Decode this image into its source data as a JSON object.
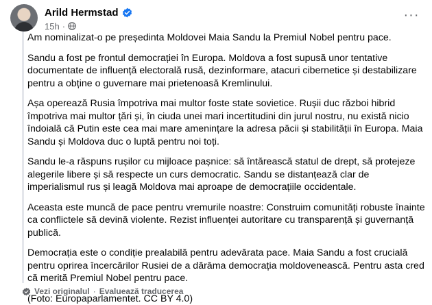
{
  "post": {
    "author": "Arild Hermstad",
    "time": "15h",
    "separator": "·",
    "more_label": "···",
    "paragraphs": [
      "Am nominalizat-o pe președinta Moldovei Maia Sandu la Premiul Nobel pentru pace.",
      "Sandu a fost pe frontul democrației în Europa. Moldova a fost supusă unor tentative documentate de influență electorală rusă, dezinformare, atacuri cibernetice și destabilizare pentru a obține o guvernare mai prietenoasă Kremlinului.",
      "Așa operează Rusia împotriva mai multor foste state sovietice. Rușii duc război hibrid împotriva mai multor țări și, în ciuda unei mari incertitudini din jurul nostru, nu există nicio îndoială că Putin este cea mai mare amenințare la adresa păcii și stabilității în Europa. Maia Sandu și Moldova duc o luptă pentru noi toți.",
      "Sandu le-a răspuns rușilor cu mijloace pașnice: să întărească statul de drept, să protejeze alegerile libere și să respecte un curs democratic. Sandu se distanțează clar de imperialismul rus și leagă Moldova mai aproape de democrațiile occidentale.",
      "Aceasta este muncă de pace pentru vremurile noastre: Construim comunități robuste înainte ca conflictele să devină violente. Rezist influenței autoritare cu transparență și guvernanță publică.",
      "Democrația este o condiție prealabilă pentru adevărata pace. Maia Sandu a fost crucială pentru oprirea încercărilor Rusiei de a dărâma democrația moldovenească. Pentru asta cred că merită Premiul Nobel pentru pace.",
      "(Foto: Europaparlamentet. CC BY 4.0)"
    ]
  },
  "footer": {
    "view_original": "Vezi originalul",
    "separator": "·",
    "rate_translation": "Evaluează traducerea"
  },
  "icons": {
    "verified": "verified-badge-icon",
    "audience": "globe-icon",
    "translate": "translate-icon"
  },
  "colors": {
    "verified": "#1877f2",
    "secondary_text": "#65676b",
    "quote_border": "#e4e6eb"
  }
}
